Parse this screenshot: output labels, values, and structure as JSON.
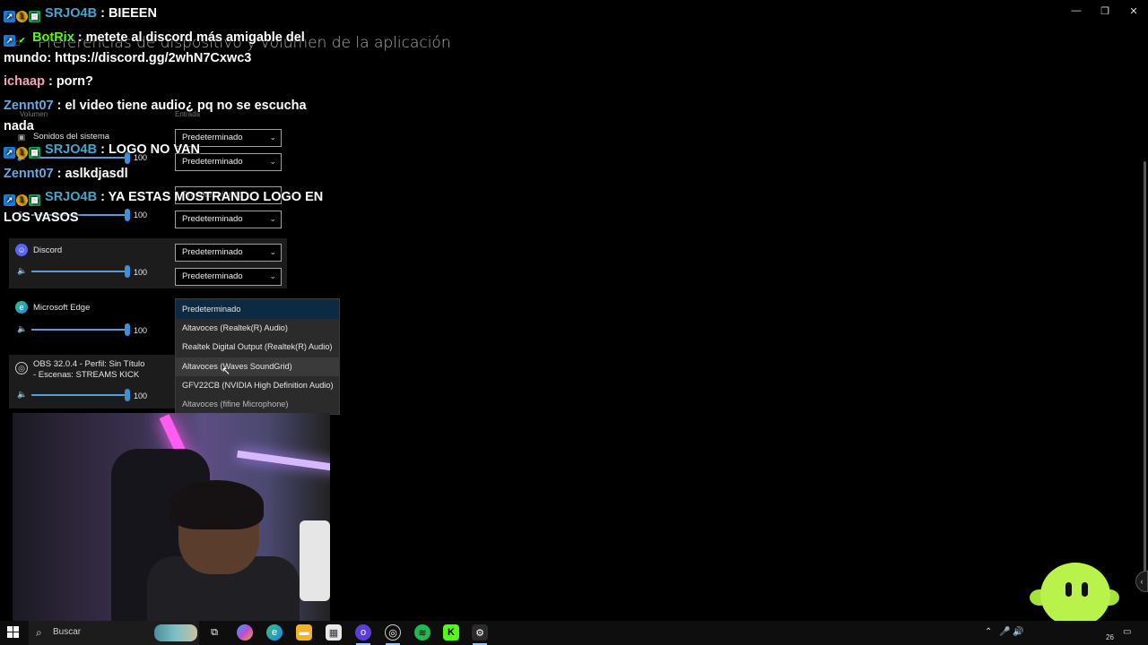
{
  "window": {
    "title": "Preferencias de dispositivo y volumen de la aplicación",
    "controls": {
      "minimize": "—",
      "restore": "❐",
      "close": "✕"
    }
  },
  "columns": {
    "volume": "Volumen",
    "input": "Entrada"
  },
  "apps": [
    {
      "name": "Sonidos del sistema",
      "volume": "100",
      "output": "Predeterminado",
      "input": "Predeterminado"
    },
    {
      "name": "",
      "volume": "100",
      "output": "Predeterminado",
      "input": "Predeterminado"
    },
    {
      "name": "Discord",
      "volume": "100",
      "output": "Predeterminado",
      "input": "Predeterminado"
    },
    {
      "name": "Microsoft Edge",
      "volume": "100",
      "output": "Predeterminado",
      "input": ""
    },
    {
      "name": "OBS 32.0.4 - Perfil: Sin Título - Escenas: STREAMS KICK",
      "name_line1": "OBS 32.0.4 - Perfil: Sin Título",
      "name_line2": "- Escenas: STREAMS KICK",
      "volume": "100"
    }
  ],
  "dropdown": {
    "options": [
      "Predeterminado",
      "Altavoces (Realtek(R) Audio)",
      "Realtek Digital Output (Realtek(R) Audio)",
      "Altavoces (Waves SoundGrid)",
      "GFV22CB (NVIDIA High Definition Audio)",
      "Altavoces (fifine Microphone)"
    ],
    "selected": 0,
    "hovered": 3
  },
  "chat": [
    {
      "user": "SRJO4B",
      "text": " : BIEEEN",
      "color": "teal",
      "badges": [
        "blue",
        "gold",
        "green"
      ]
    },
    {
      "user": "BotRix",
      "text": " : metete al discord más amigable del mundo: https://discord.gg/2whN7Cxwc3",
      "color": "green",
      "badges": [
        "blue",
        "check"
      ]
    },
    {
      "user": "ichaap",
      "text": " : porn?",
      "color": "pink",
      "badges": []
    },
    {
      "user": "Zennt07",
      "text": " : el video tiene audio¿ pq no se escucha nada",
      "color": "blue",
      "badges": []
    },
    {
      "user": "SRJO4B",
      "text": " : LOGO NO VAN",
      "color": "teal",
      "badges": [
        "blue",
        "gold",
        "green"
      ]
    },
    {
      "user": "Zennt07",
      "text": " : aslkdjasdl",
      "color": "blue",
      "badges": []
    },
    {
      "user": "SRJO4B",
      "text": " : YA ESTAS MOSTRANDO LOGO EN LOS VASOS",
      "color": "teal",
      "badges": [
        "blue",
        "gold",
        "green"
      ]
    }
  ],
  "taskbar": {
    "search_placeholder": "Buscar",
    "icons": [
      "task-view-icon",
      "copilot-icon",
      "edge-icon",
      "file-explorer-icon",
      "store-icon",
      "opera-gx-icon",
      "obs-icon",
      "spotify-icon",
      "kick-icon",
      "settings-icon"
    ],
    "clock_fragment": "26"
  },
  "colors": {
    "accent": "#3f8fd8",
    "selected_item": "#0d2a44",
    "kick_green": "#53fc18",
    "spotify_green": "#1db954"
  }
}
